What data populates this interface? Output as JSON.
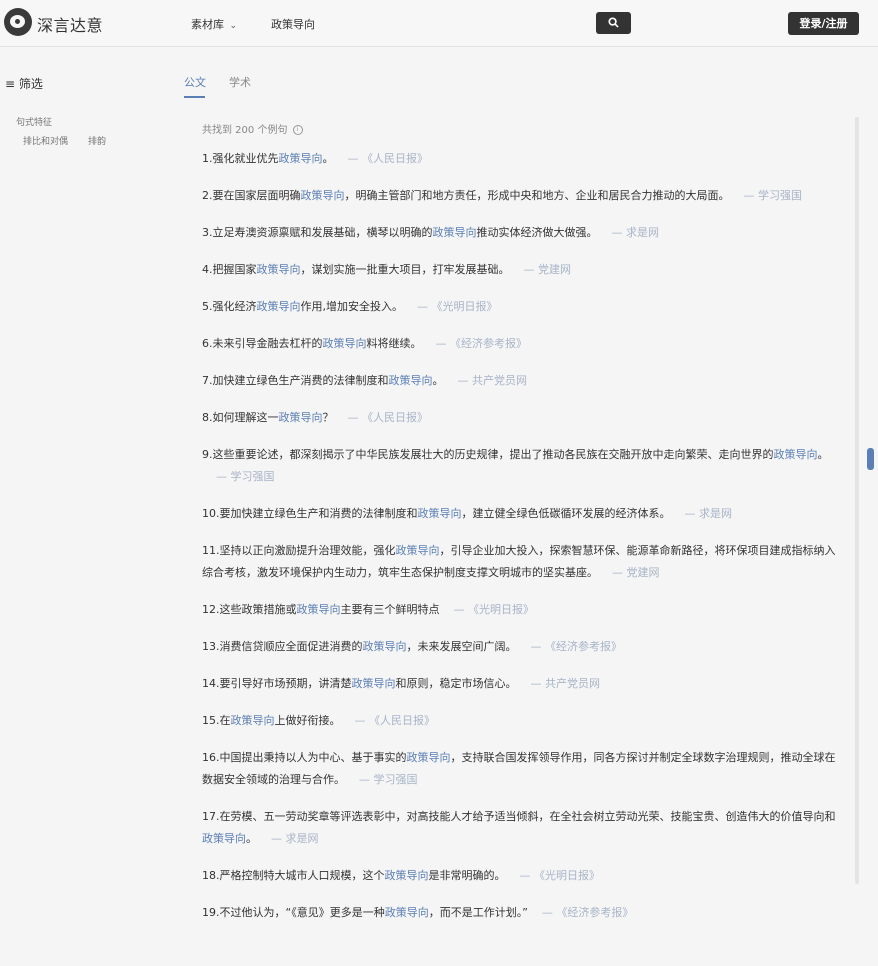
{
  "brand": {
    "name": "深言达意"
  },
  "nav": {
    "library": "素材库",
    "policy": "政策导向"
  },
  "auth": {
    "login_label": "登录/注册"
  },
  "search": {
    "icon": "search-icon"
  },
  "sidebar": {
    "title": "筛选",
    "group_label": "句式特征",
    "options": [
      "排比和对偶",
      "排韵"
    ]
  },
  "tabs": [
    {
      "label": "公文",
      "active": true
    },
    {
      "label": "学术",
      "active": false
    }
  ],
  "result_count": "共找到 200 个例句",
  "keyword": "政策导向",
  "accent_color": "#5b7fb4",
  "results": [
    {
      "prefix": "1.强化就业优先",
      "suffix": "。",
      "source": "— 《人民日报》"
    },
    {
      "prefix": "2.要在国家层面明确",
      "suffix": "，明确主管部门和地方责任，形成中央和地方、企业和居民合力推动的大局面。",
      "source": "— 学习强国"
    },
    {
      "prefix": "3.立足寿澳资源禀赋和发展基础，横琴以明确的",
      "suffix": "推动实体经济做大做强。",
      "source": "— 求是网"
    },
    {
      "prefix": "4.把握国家",
      "suffix": "，谋划实施一批重大项目，打牢发展基础。",
      "source": "— 党建网"
    },
    {
      "prefix": "5.强化经济",
      "suffix": "作用,增加安全投入。",
      "source": "— 《光明日报》"
    },
    {
      "prefix": "6.未来引导金融去杠杆的",
      "suffix": "料将继续。",
      "source": "— 《经济参考报》"
    },
    {
      "prefix": "7.加快建立绿色生产消费的法律制度和",
      "suffix": "。",
      "source": "— 共产党员网"
    },
    {
      "prefix": "8.如何理解这一",
      "suffix": "？",
      "source": "— 《人民日报》"
    },
    {
      "prefix": "9.这些重要论述，都深刻揭示了中华民族发展壮大的历史规律，提出了推动各民族在交融开放中走向繁荣、走向世界的",
      "suffix": "。",
      "source": "— 学习强国"
    },
    {
      "prefix": "10.要加快建立绿色生产和消费的法律制度和",
      "suffix": "，建立健全绿色低碳循环发展的经济体系。",
      "source": "— 求是网"
    },
    {
      "prefix": "11.坚持以正向激励提升治理效能，强化",
      "suffix": "，引导企业加大投入，探索智慧环保、能源革命新路径，将环保项目建成指标纳入综合考核，激发环境保护内生动力，筑牢生态保护制度支撑文明城市的坚实基座。",
      "source": "— 党建网"
    },
    {
      "prefix": "12.这些政策措施或",
      "suffix": "主要有三个鲜明特点",
      "source": "— 《光明日报》"
    },
    {
      "prefix": "13.消费信贷顺应全面促进消费的",
      "suffix": "，未来发展空间广阔。",
      "source": "— 《经济参考报》"
    },
    {
      "prefix": "14.要引导好市场预期，讲清楚",
      "suffix": "和原则，稳定市场信心。",
      "source": "— 共产党员网"
    },
    {
      "prefix": "15.在",
      "suffix": "上做好衔接。",
      "source": "— 《人民日报》"
    },
    {
      "prefix": "16.中国提出秉持以人为中心、基于事实的",
      "suffix": "，支持联合国发挥领导作用，同各方探讨并制定全球数字治理规则，推动全球在数据安全领域的治理与合作。",
      "source": "— 学习强国"
    },
    {
      "prefix": "17.在劳模、五一劳动奖章等评选表彰中，对高技能人才给予适当倾斜，在全社会树立劳动光荣、技能宝贵、创造伟大的价值导向和",
      "suffix": "。",
      "source": "— 求是网"
    },
    {
      "prefix": "18.严格控制特大城市人口规模，这个",
      "suffix": "是非常明确的。",
      "source": "— 《光明日报》"
    },
    {
      "prefix": "19.不过他认为，“《意见》更多是一种",
      "suffix": "，而不是工作计划。”",
      "source": "— 《经济参考报》"
    }
  ]
}
